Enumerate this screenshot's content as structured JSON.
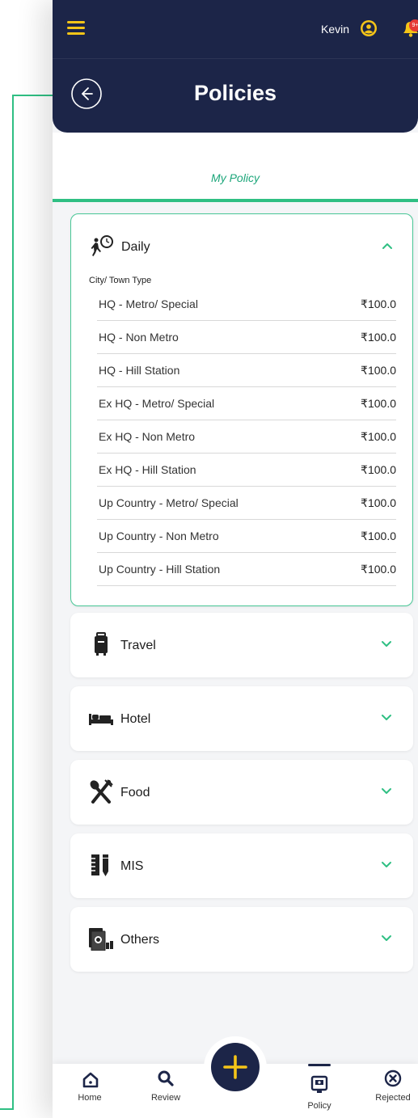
{
  "header": {
    "user_name": "Kevin",
    "notification_badge": "9+",
    "title": "Policies"
  },
  "tabs": {
    "my_policy": "My Policy"
  },
  "cards": [
    {
      "label": "Daily",
      "icon": "commuter-clock-icon",
      "expanded": true,
      "sub_heading": "City/ Town Type",
      "rows": [
        {
          "name": "HQ - Metro/ Special",
          "amount": "₹100.0"
        },
        {
          "name": "HQ - Non Metro",
          "amount": "₹100.0"
        },
        {
          "name": "HQ - Hill Station",
          "amount": "₹100.0"
        },
        {
          "name": "Ex HQ - Metro/ Special",
          "amount": "₹100.0"
        },
        {
          "name": "Ex HQ - Non Metro",
          "amount": "₹100.0"
        },
        {
          "name": "Ex HQ - Hill Station",
          "amount": "₹100.0"
        },
        {
          "name": "Up Country - Metro/ Special",
          "amount": "₹100.0"
        },
        {
          "name": "Up Country - Non Metro",
          "amount": "₹100.0"
        },
        {
          "name": "Up Country - Hill Station",
          "amount": "₹100.0"
        }
      ]
    },
    {
      "label": "Travel",
      "icon": "luggage-icon",
      "expanded": false
    },
    {
      "label": "Hotel",
      "icon": "bed-icon",
      "expanded": false
    },
    {
      "label": "Food",
      "icon": "fork-spoon-icon",
      "expanded": false
    },
    {
      "label": "MIS",
      "icon": "ruler-pencil-icon",
      "expanded": false
    },
    {
      "label": "Others",
      "icon": "documents-icon",
      "expanded": false
    }
  ],
  "bottom_nav": {
    "home": "Home",
    "review": "Review",
    "policy": "Policy",
    "rejected": "Rejected"
  },
  "colors": {
    "header_bg": "#1c2548",
    "accent_green": "#2fbf83",
    "accent_yellow": "#f5c518",
    "badge_red": "#e53935"
  }
}
